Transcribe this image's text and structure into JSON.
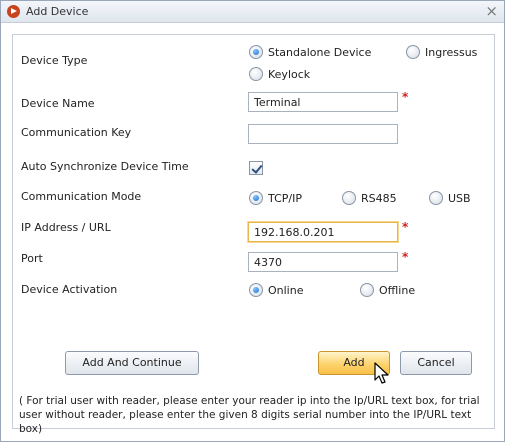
{
  "window": {
    "title": "Add Device",
    "close_glyph": "×",
    "icon": "app-logo-icon"
  },
  "form": {
    "device_type": {
      "label": "Device Type",
      "options": [
        "Standalone Device",
        "Ingressus",
        "Keylock"
      ],
      "selected": "Standalone Device"
    },
    "device_name": {
      "label": "Device Name",
      "value": "Terminal",
      "required": "*"
    },
    "communication_key": {
      "label": "Communication Key",
      "value": ""
    },
    "auto_sync": {
      "label": "Auto Synchronize Device Time",
      "checked": true
    },
    "communication_mode": {
      "label": "Communication Mode",
      "options": [
        "TCP/IP",
        "RS485",
        "USB"
      ],
      "selected": "TCP/IP"
    },
    "ip_address": {
      "label": "IP Address / URL",
      "value": "192.168.0.201",
      "required": "*"
    },
    "port": {
      "label": "Port",
      "value": "4370",
      "required": "*"
    },
    "device_activation": {
      "label": "Device Activation",
      "options": [
        "Online",
        "Offline"
      ],
      "selected": "Online"
    }
  },
  "buttons": {
    "add_and_continue": "Add And Continue",
    "add": "Add",
    "cancel": "Cancel"
  },
  "note": "( For trial user with reader, please enter your reader ip into the Ip/URL text box, for trial user without reader, please enter the given 8 digits serial number into the IP/URL text box)",
  "colors": {
    "accent": "#1e6fd1",
    "required": "#d62020",
    "hot_button": "#fdd36d",
    "app_icon": "#c8441c"
  }
}
